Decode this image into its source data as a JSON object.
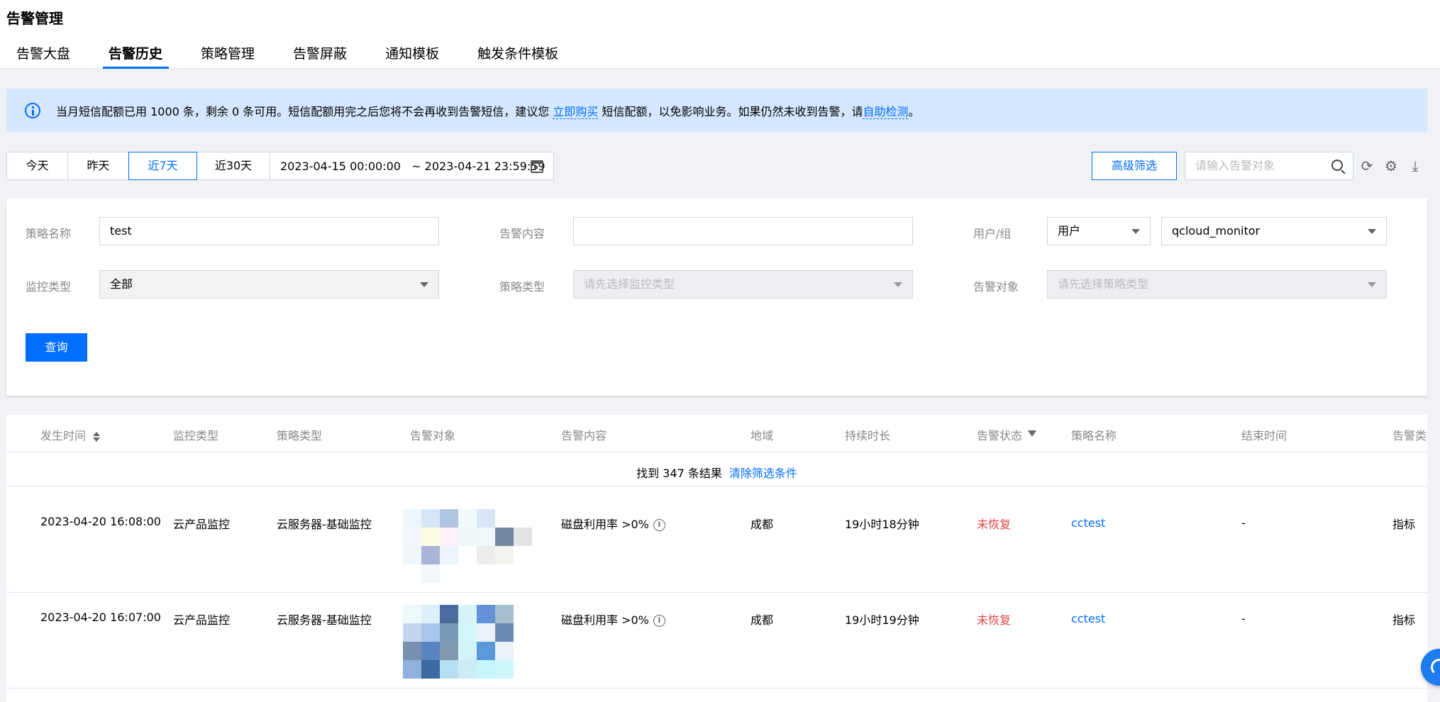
{
  "header": {
    "title": "告警管理",
    "tabs": [
      {
        "label": "告警大盘"
      },
      {
        "label": "告警历史"
      },
      {
        "label": "策略管理"
      },
      {
        "label": "告警屏蔽"
      },
      {
        "label": "通知模板"
      },
      {
        "label": "触发条件模板"
      }
    ],
    "active_tab": "告警历史"
  },
  "notice": {
    "text_1": "当月短信配额已用 1000 条，剩余 0 条可用。短信配额用完之后您将不会再收到告警短信，建议您 ",
    "buy_link": "立即购买",
    "text_2": " 短信配额，以免影响业务。如果仍然未收到告警，请",
    "self_check_link": "自助检测",
    "text_3": "。"
  },
  "toolbar": {
    "time_options": [
      "今天",
      "昨天",
      "近7天",
      "近30天"
    ],
    "active_time": "近7天",
    "date_range": "2023-04-15 00:00:00   ~ 2023-04-21 23:59:59",
    "advanced_filter": "高级筛选",
    "search_placeholder": "请输入告警对象"
  },
  "filter": {
    "policy_name_label": "策略名称",
    "policy_name_value": "test",
    "alarm_content_label": "告警内容",
    "alarm_content_value": "",
    "user_group_label": "用户/组",
    "user_group_type": "用户",
    "user_group_value": "qcloud_monitor",
    "monitor_type_label": "监控类型",
    "monitor_type_value": "全部",
    "policy_type_label": "策略类型",
    "policy_type_placeholder": "请先选择监控类型",
    "alarm_object_label": "告警对象",
    "alarm_object_placeholder": "请先选择策略类型",
    "query_button": "查询"
  },
  "table": {
    "columns": [
      "发生时间",
      "监控类型",
      "策略类型",
      "告警对象",
      "告警内容",
      "地域",
      "持续时长",
      "告警状态",
      "策略名称",
      "结束时间",
      "告警类"
    ],
    "result_text": "找到 347 条结果",
    "clear_filter": "清除筛选条件",
    "rows": [
      {
        "time": "2023-04-20 16:08:00",
        "monitor_type": "云产品监控",
        "policy_type": "云服务器-基础监控",
        "content": "磁盘利用率 >0%",
        "region": "成都",
        "duration": "19小时18分钟",
        "status": "未恢复",
        "policy_name": "cctest",
        "end_time": "-",
        "alarm_type": "指标"
      },
      {
        "time": "2023-04-20 16:07:00",
        "monitor_type": "云产品监控",
        "policy_type": "云服务器-基础监控",
        "content": "磁盘利用率 >0%",
        "region": "成都",
        "duration": "19小时19分钟",
        "status": "未恢复",
        "policy_name": "cctest",
        "end_time": "-",
        "alarm_type": "指标"
      }
    ]
  },
  "colors": {
    "accent": "#006eff",
    "notice_bg": "#d5e7ff",
    "status_red": "#e54545"
  }
}
